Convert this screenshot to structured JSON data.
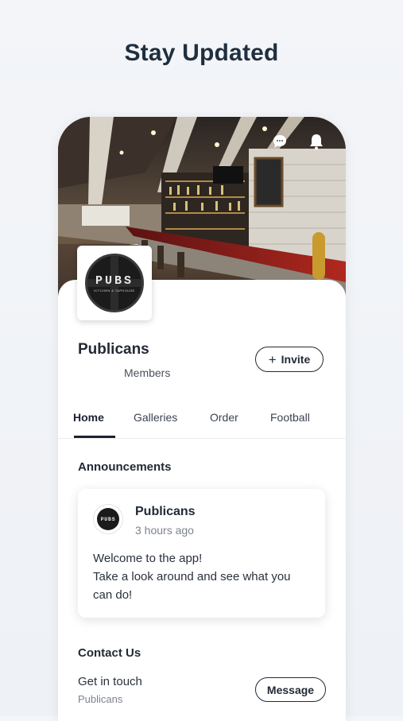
{
  "headline": "Stay Updated",
  "cover": {
    "icons": [
      "chat-icon",
      "bell-icon"
    ]
  },
  "group": {
    "logo_text": "PUBS",
    "logo_subtext": "KITCHEN & TAPHOUSE",
    "name": "Publicans",
    "members_label": "Members",
    "invite_label": "Invite",
    "invite_icon": "plus-icon"
  },
  "tabs": [
    {
      "label": "Home",
      "active": true
    },
    {
      "label": "Galleries",
      "active": false
    },
    {
      "label": "Order",
      "active": false
    },
    {
      "label": "Football",
      "active": false
    }
  ],
  "announcements": {
    "title": "Announcements",
    "post": {
      "avatar_text": "PUBS",
      "author": "Publicans",
      "time": "3 hours ago",
      "body_lines": [
        "Welcome to the app!",
        "Take a look around and see what you",
        "can do!"
      ]
    }
  },
  "contact": {
    "title": "Contact Us",
    "line": "Get in touch",
    "sub": "Publicans",
    "message_label": "Message"
  },
  "colors": {
    "text_primary": "#222a35",
    "headline": "#1f2f3f",
    "muted": "#7d838d",
    "bar_counter": "#8b1d1d"
  }
}
